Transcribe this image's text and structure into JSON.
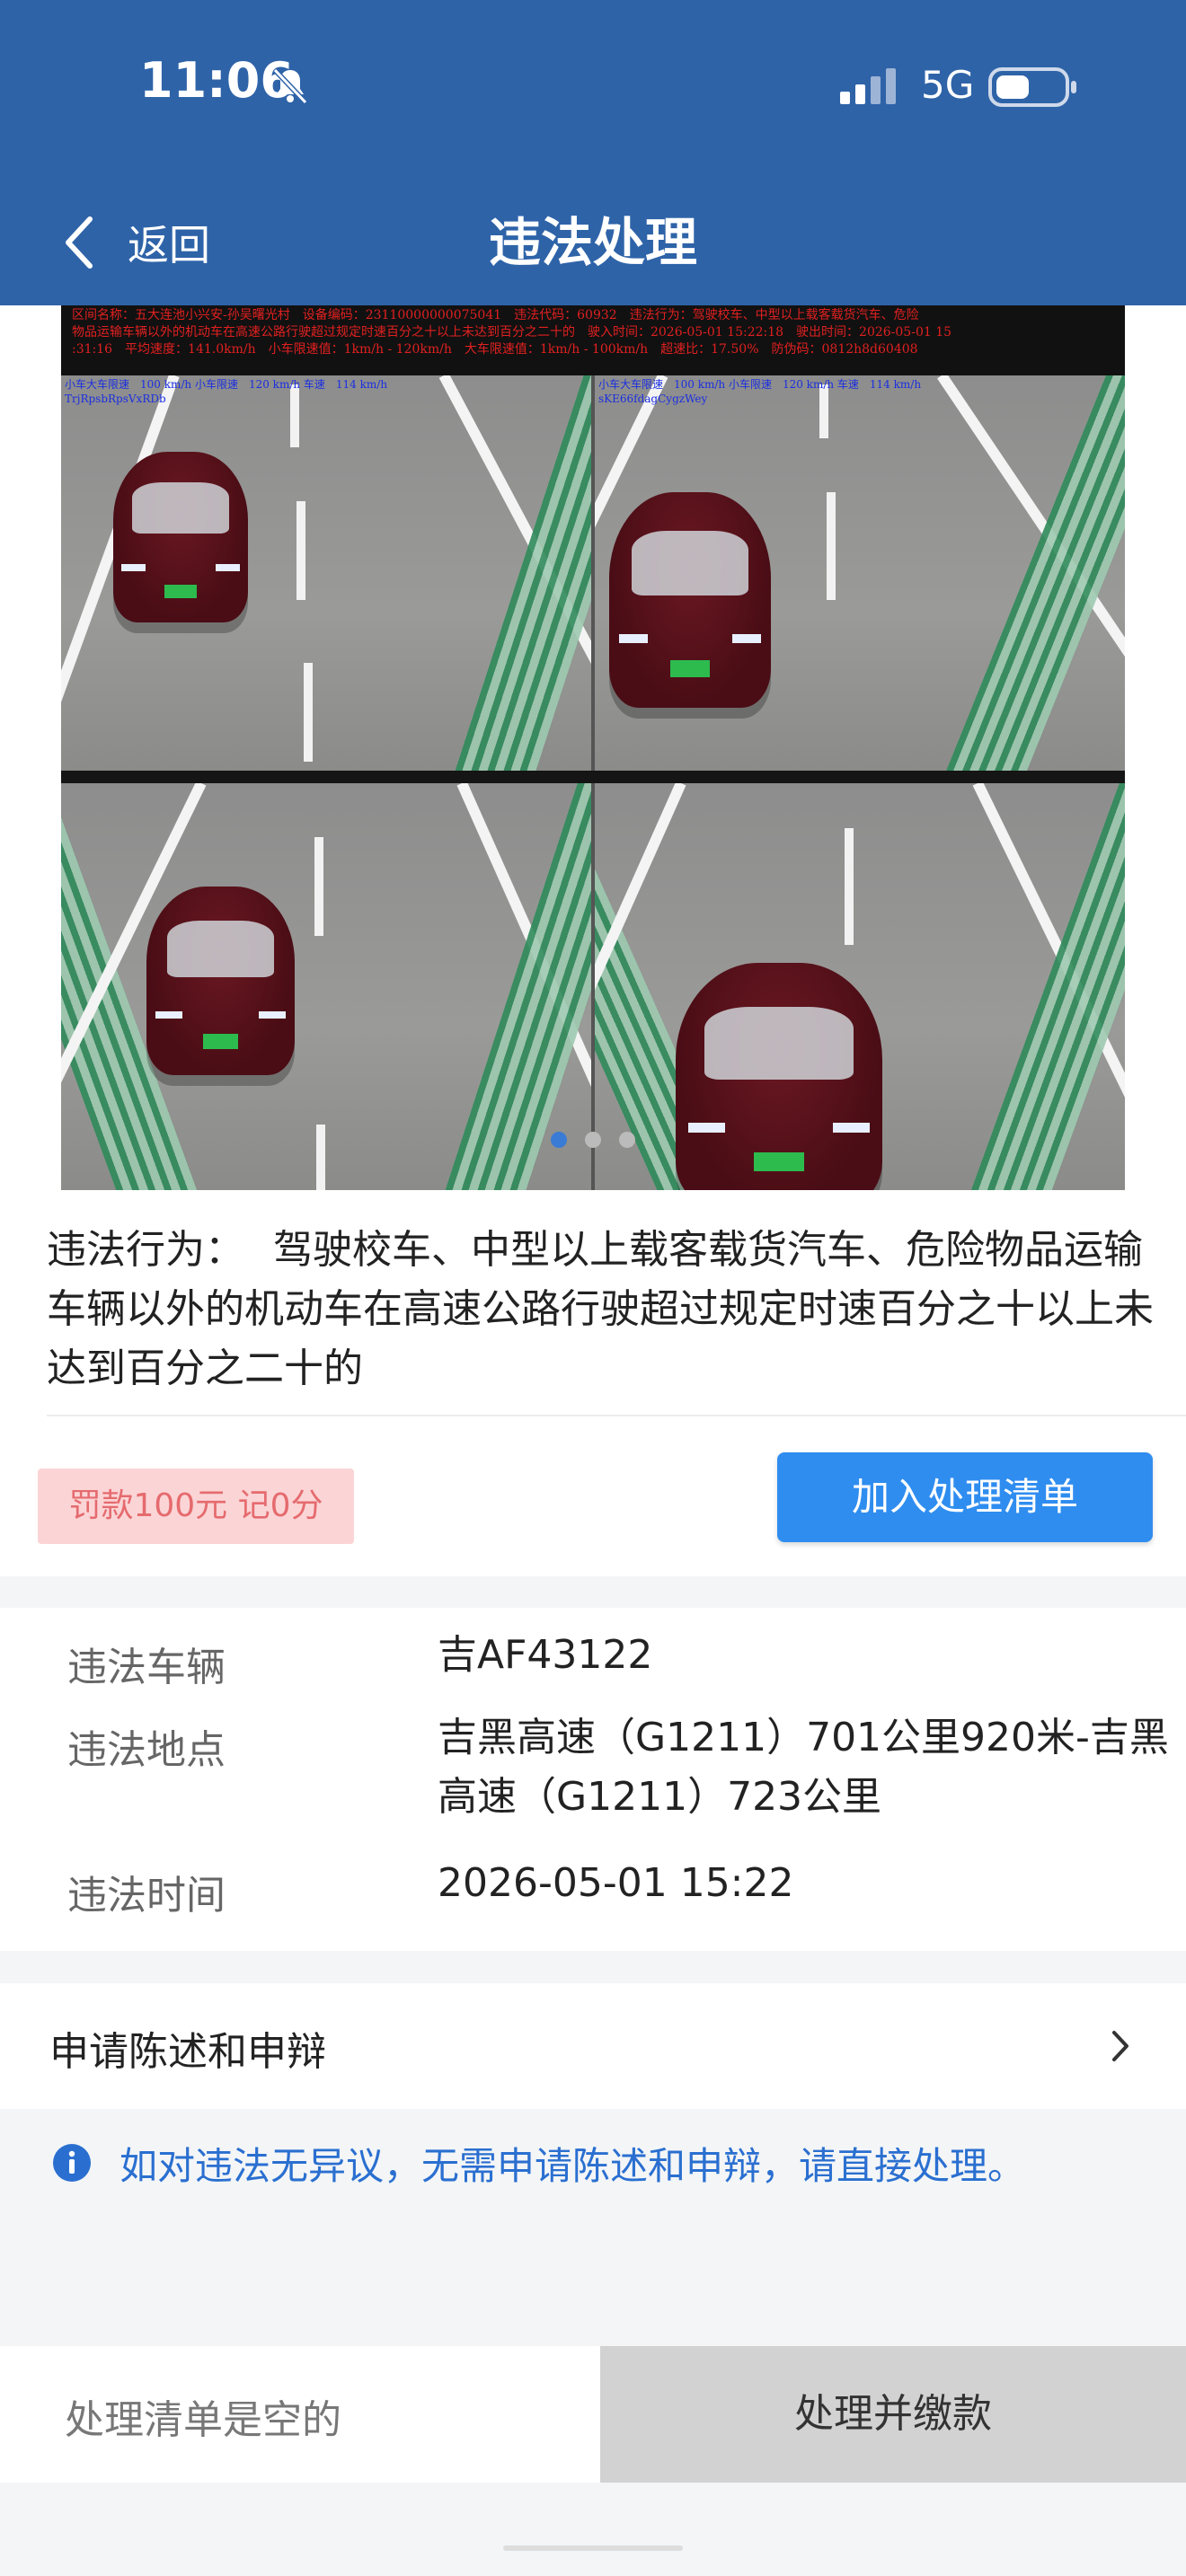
{
  "status_bar": {
    "time": "11:06",
    "network": "5G"
  },
  "nav": {
    "back_label": "返回",
    "title": "违法处理"
  },
  "photo": {
    "info_line1": "区间名称：五大连池小兴安-孙吴曙光村　设备编码：23110000000075041　违法代码：60932　违法行为：驾驶校车、中型以上载客载货汽车、危险",
    "info_line2": "物品运输车辆以外的机动车在高速公路行驶超过规定时速百分之十以上未达到百分之二十的　驶入时间：2026-05-01 15:22:18　驶出时间：2026-05-01 15",
    "info_line3": ":31:16　平均速度：141.0km/h　小车限速值：1km/h - 120km/h　大车限速值：1km/h - 100km/h　超速比：17.50%　防伪码：0812h8d60408",
    "frame_overlays": [
      "小车大车限速　100 km/h 小车限速　120 km/h 车速　114 km/h",
      "小车大车限速　100 km/h 小车限速　120 km/h 车速　114 km/h",
      "",
      ""
    ],
    "frame_codes": [
      "TrjRpsbRpsVxRDb",
      "sKE66fdagCygzWey",
      "",
      ""
    ],
    "page_count": 3,
    "active_page": 1
  },
  "violation": {
    "label": "违法行为：",
    "description": "驾驶校车、中型以上载客载货汽车、危险物品运输车辆以外的机动车在高速公路行驶超过规定时速百分之十以上未达到百分之二十的",
    "fine": "罚款100元 记0分",
    "add_button": "加入处理清单"
  },
  "details": {
    "vehicle_label": "违法车辆",
    "vehicle_value": "吉AF43122",
    "location_label": "违法地点",
    "location_value": "吉黑高速（G1211）701公里920米-吉黑高速（G1211）723公里",
    "time_label": "违法时间",
    "time_value": "2026-05-01 15:22"
  },
  "appeal": {
    "label": "申请陈述和申辩"
  },
  "notice": {
    "text": "如对违法无异议，无需申请陈述和申辩，请直接处理。"
  },
  "bottom": {
    "cart_status": "处理清单是空的",
    "pay_button": "处理并缴款"
  },
  "colors": {
    "header": "#2e63a8",
    "primary_button": "#2f8df0",
    "fine_bg": "#fbd4d6",
    "fine_text": "#e56b6e",
    "notice_text": "#2a6fd0"
  }
}
